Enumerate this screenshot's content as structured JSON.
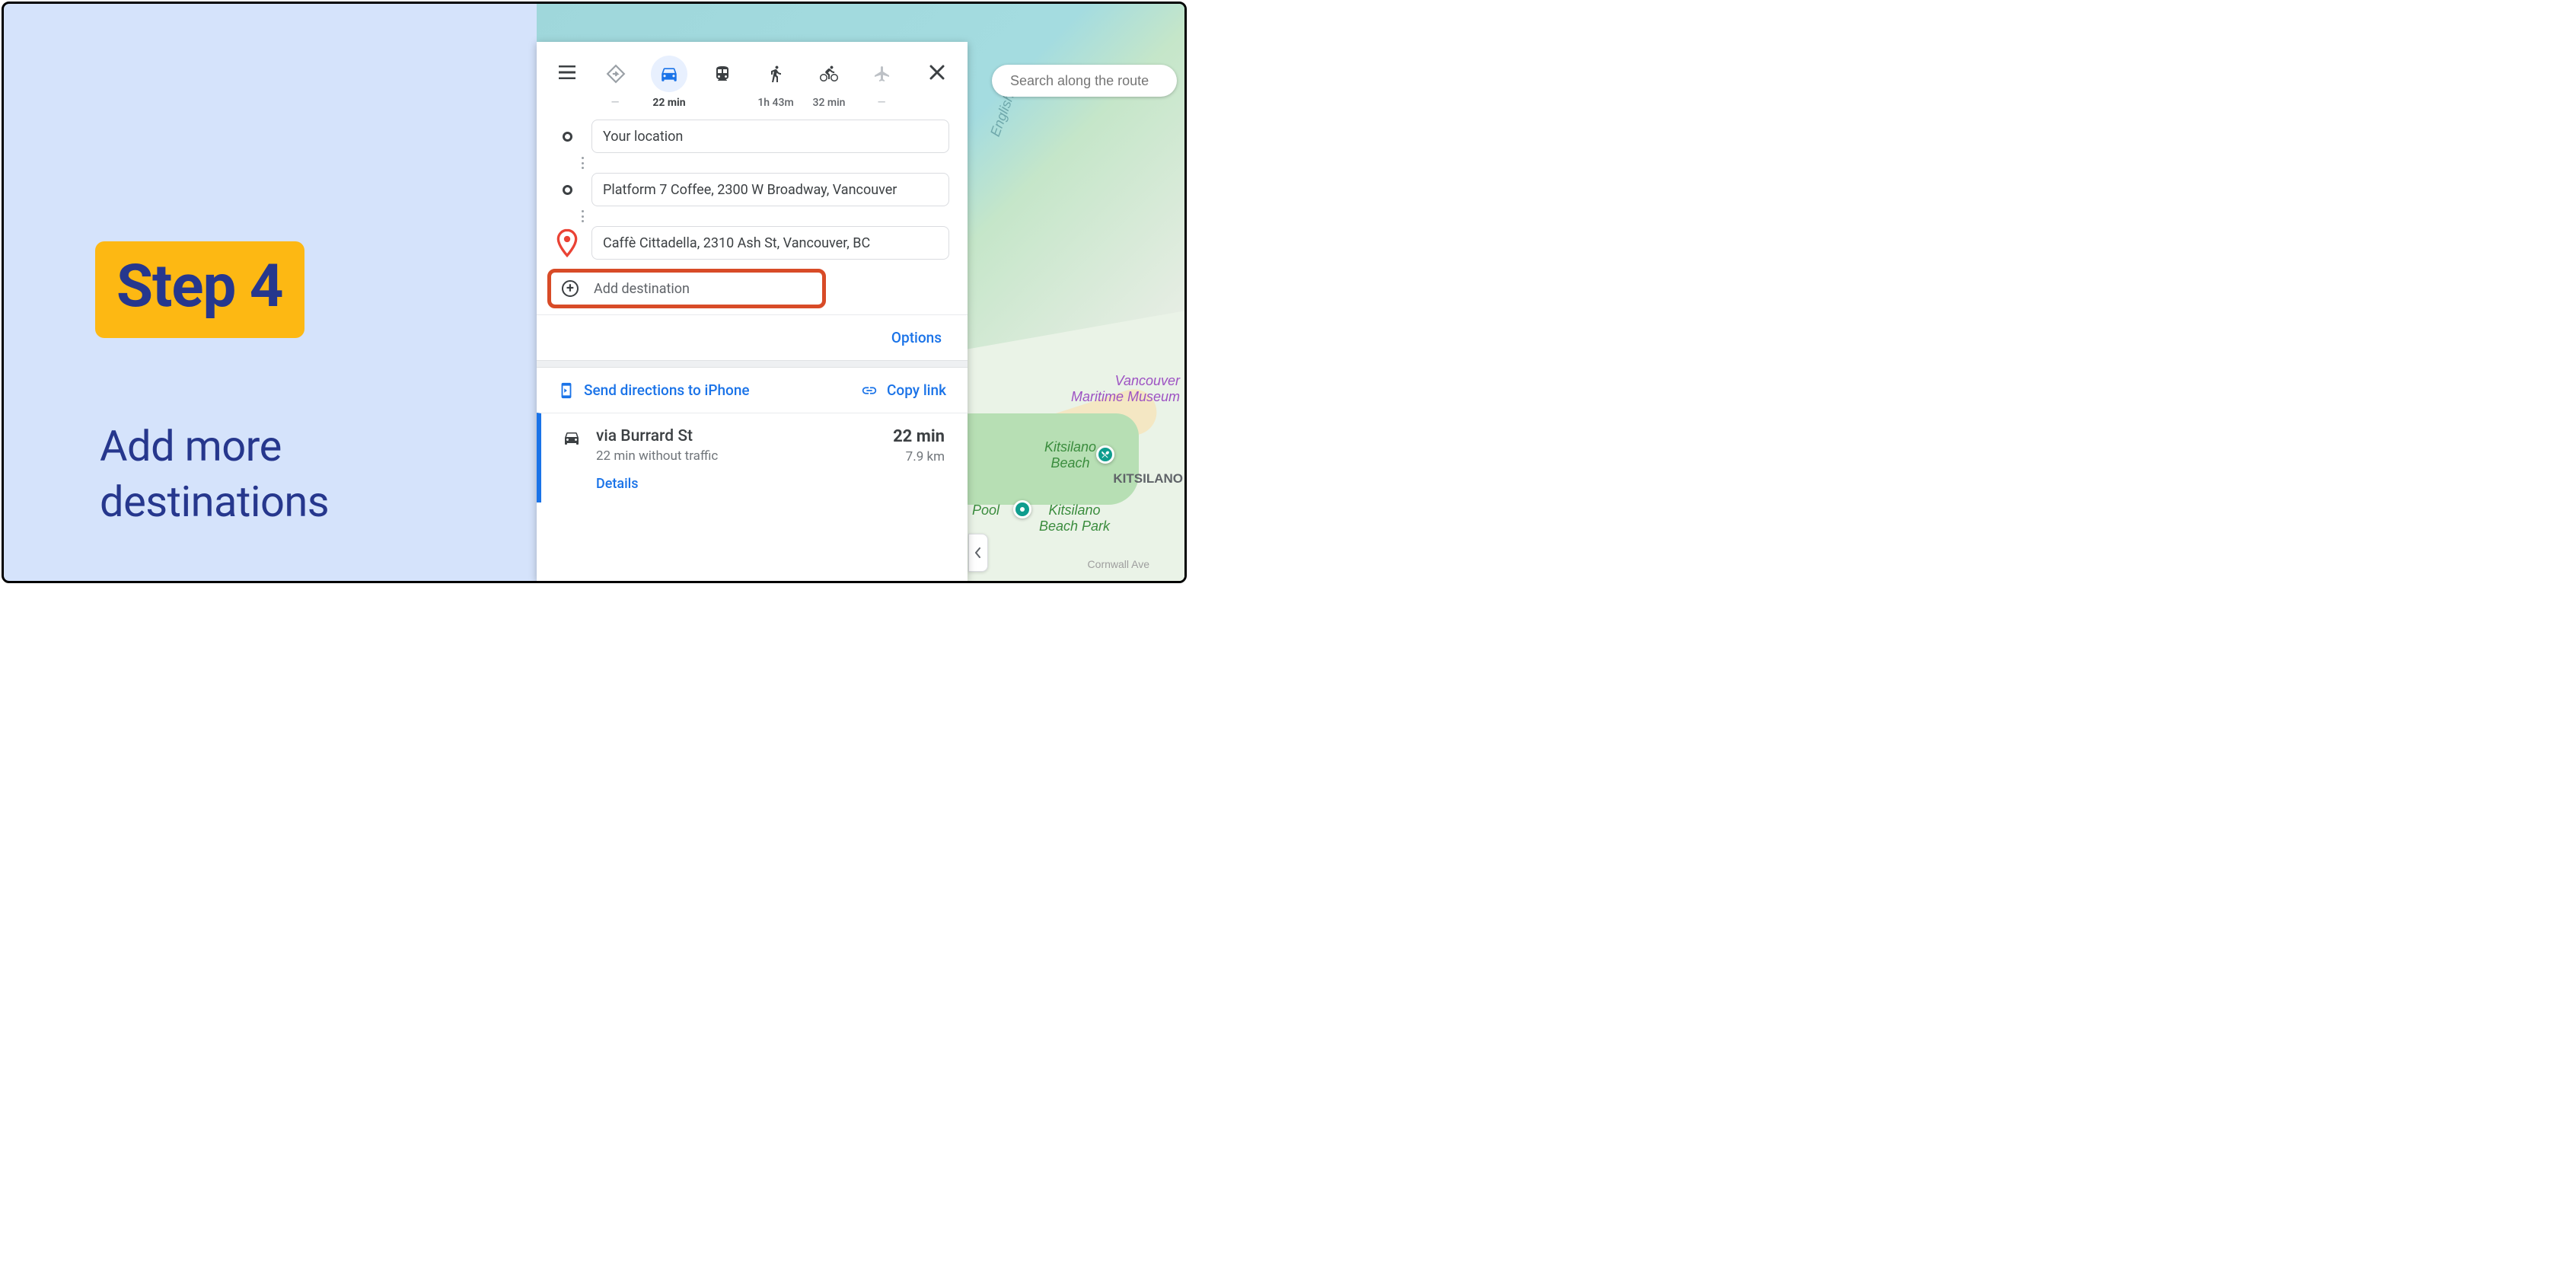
{
  "instruction": {
    "badge": "Step 4",
    "text": "Add more\ndestinations"
  },
  "search": {
    "placeholder": "Search along the route"
  },
  "modes": {
    "best": {
      "sub": "—"
    },
    "driving": {
      "sub": "22 min"
    },
    "transit": {
      "sub": ""
    },
    "walking": {
      "sub": "1h 43m"
    },
    "cycling": {
      "sub": "32 min"
    },
    "flight": {
      "sub": "—"
    }
  },
  "waypoints": [
    {
      "text": "Your location"
    },
    {
      "text": "Platform 7 Coffee, 2300 W Broadway, Vancouver"
    },
    {
      "text": "Caffè Cittadella, 2310 Ash St, Vancouver, BC"
    }
  ],
  "add_destination_label": "Add destination",
  "options_label": "Options",
  "share": {
    "send": "Send directions to iPhone",
    "copy": "Copy link"
  },
  "route": {
    "title": "via Burrard St",
    "sub": "22 min without traffic",
    "details": "Details",
    "time": "22 min",
    "distance": "7.9 km"
  },
  "map_labels": {
    "bay": "English Bay",
    "maritime": "Vancouver\nMaritime Museum",
    "kits_beach": "Kitsilano\nBeach",
    "kits_park": "Kitsilano\nBeach Park",
    "pool": "Pool",
    "kits_side": "KITSILANO",
    "cornwall": "Cornwall Ave"
  }
}
